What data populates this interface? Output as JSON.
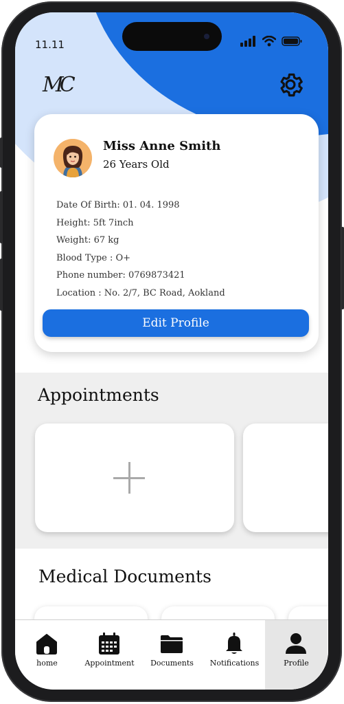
{
  "status_bar": {
    "time": "11.11"
  },
  "header": {
    "logo_text": "MC"
  },
  "profile": {
    "name": "Miss Anne Smith",
    "age": "26 Years Old",
    "details": [
      "Date Of Birth: 01. 04. 1998",
      "Height: 5ft 7inch",
      "Weight: 67 kg",
      "Blood Type :  O+",
      "Phone number: 0769873421",
      "Location :  No. 2/7, BC Road, Aokland"
    ],
    "edit_button": "Edit Profile"
  },
  "appointments": {
    "title": "Appointments"
  },
  "documents": {
    "title": "Medical Documents"
  },
  "nav": {
    "items": [
      {
        "label": "home",
        "icon": "home-icon"
      },
      {
        "label": "Appointment",
        "icon": "calendar-icon"
      },
      {
        "label": "Documents",
        "icon": "folder-icon"
      },
      {
        "label": "Notifications",
        "icon": "bell-icon"
      },
      {
        "label": "Profile",
        "icon": "user-icon"
      }
    ],
    "active": "Profile"
  },
  "colors": {
    "accent": "#1b6fe0",
    "light_accent": "#d4e4fb",
    "section_bg": "#efefef"
  }
}
